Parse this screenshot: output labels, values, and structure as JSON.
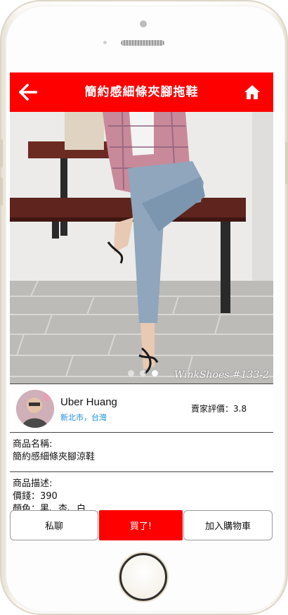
{
  "header": {
    "title": "簡約感細條夾腳拖鞋",
    "back_icon": "arrow-left-icon",
    "home_icon": "home-icon"
  },
  "product_image": {
    "watermark": "WinkShoes #133-2",
    "carousel_count": 3,
    "carousel_active_index": 2
  },
  "seller": {
    "name": "Uber Huang",
    "location": "新北市，台灣",
    "rating_label": "賣家評價：3.8"
  },
  "product_info": {
    "name_label": "商品名稱:",
    "name_value": "簡約感細條夾腳涼鞋",
    "desc_label": "商品描述:",
    "desc_lines": [
      "價錢：390",
      "顏色：黑、杏、白"
    ]
  },
  "actions": {
    "chat_label": "私聊",
    "buy_label": "買了!",
    "cart_label": "加入購物車"
  },
  "colors": {
    "accent": "#ff0000",
    "link": "#1a8fd8"
  }
}
